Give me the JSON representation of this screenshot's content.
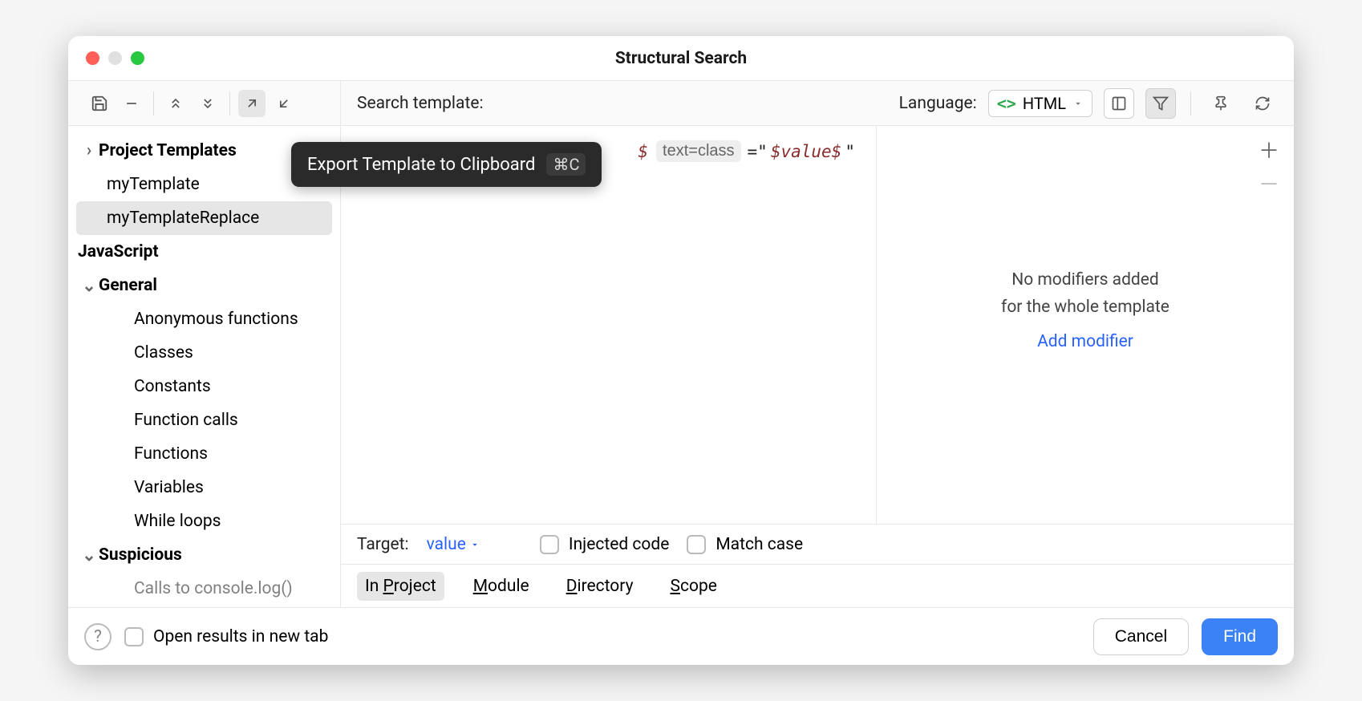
{
  "title": "Structural Search",
  "tooltip": {
    "text": "Export Template to Clipboard",
    "shortcut": "⌘C"
  },
  "header": {
    "search_label": "Search template:",
    "language_label": "Language:",
    "language_value": "HTML"
  },
  "sidebar": {
    "groups": [
      {
        "label": "Project Templates",
        "open": false,
        "bold": true,
        "arrow": "right",
        "items": [
          "myTemplate",
          "myTemplateReplace"
        ],
        "selected": "myTemplateReplace"
      },
      {
        "label": "JavaScript",
        "bold": true,
        "noarrow": true,
        "items": []
      },
      {
        "label": "General",
        "open": true,
        "bold": true,
        "arrow": "down",
        "items": [
          "Anonymous functions",
          "Classes",
          "Constants",
          "Function calls",
          "Functions",
          "Variables",
          "While loops"
        ]
      },
      {
        "label": "Suspicious",
        "open": true,
        "bold": true,
        "arrow": "down",
        "items": [
          "Calls to console.log()"
        ]
      }
    ]
  },
  "editor": {
    "hint": "text=class",
    "eq": "=\"",
    "value": "$value$",
    "trail": "\""
  },
  "modifiers": {
    "line1": "No modifiers added",
    "line2": "for the whole template",
    "add": "Add modifier"
  },
  "target": {
    "label": "Target:",
    "value": "value",
    "injected": "Injected code",
    "matchcase": "Match case"
  },
  "scope": {
    "tabs": [
      "In Project",
      "Module",
      "Directory",
      "Scope"
    ],
    "active": 0
  },
  "footer": {
    "newtab": "Open results in new tab",
    "cancel": "Cancel",
    "find": "Find"
  }
}
